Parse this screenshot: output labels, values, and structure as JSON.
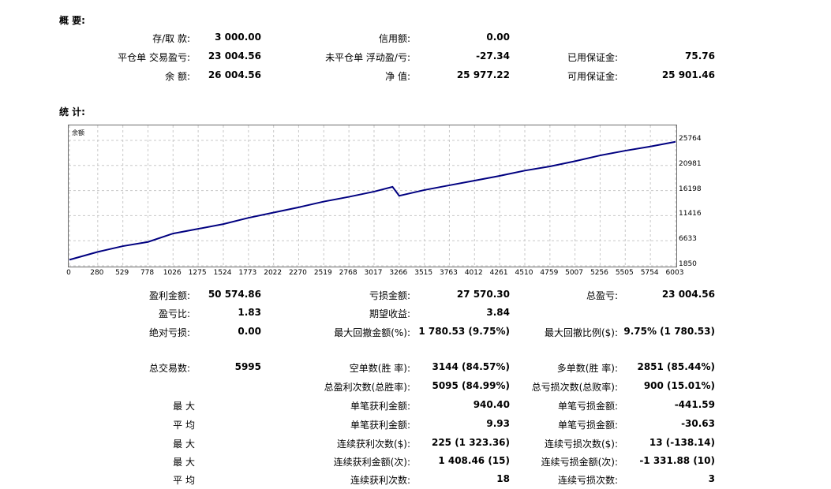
{
  "sections": {
    "summary": "概 要:",
    "stats": "统 计:"
  },
  "summary": {
    "deposit_label": "存/取 款:",
    "deposit_value": "3 000.00",
    "credit_label": "信用额:",
    "credit_value": "0.00",
    "closed_pl_label": "平仓单 交易盈亏:",
    "closed_pl_value": "23 004.56",
    "floating_pl_label": "未平仓单 浮动盈/亏:",
    "floating_pl_value": "-27.34",
    "margin_label": "已用保证金:",
    "margin_value": "75.76",
    "balance_label": "余 额:",
    "balance_value": "26 004.56",
    "equity_label": "净 值:",
    "equity_value": "25 977.22",
    "free_margin_label": "可用保证金:",
    "free_margin_value": "25 901.46"
  },
  "chart_data": {
    "type": "line",
    "series_label": "余额",
    "color": "#000080",
    "grid": true,
    "y_ticks": [
      "25764",
      "20981",
      "16198",
      "11416",
      "6633",
      "1850"
    ],
    "x_ticks": [
      "0",
      "280",
      "529",
      "778",
      "1026",
      "1275",
      "1524",
      "1773",
      "2022",
      "2270",
      "2519",
      "2768",
      "3017",
      "3266",
      "3515",
      "3763",
      "4012",
      "4261",
      "4510",
      "4759",
      "5007",
      "5256",
      "5505",
      "5754",
      "6003"
    ],
    "ylim": [
      1850,
      25764
    ],
    "xlim": [
      0,
      6003
    ],
    "series": [
      {
        "x": [
          0,
          280,
          529,
          778,
          1026,
          1275,
          1524,
          1773,
          2022,
          2270,
          2519,
          2768,
          3017,
          3200,
          3266,
          3515,
          3763,
          4012,
          4261,
          4510,
          4759,
          5007,
          5256,
          5505,
          5754,
          6003
        ],
        "values": [
          3000,
          4500,
          5600,
          6400,
          8000,
          8900,
          9800,
          11000,
          12000,
          13000,
          14100,
          15000,
          16000,
          16900,
          15200,
          16300,
          17200,
          18100,
          19000,
          20000,
          20800,
          21800,
          22900,
          23800,
          24600,
          25500
        ]
      }
    ]
  },
  "stats": {
    "gross_profit_label": "盈利金额:",
    "gross_profit_value": "50 574.86",
    "gross_loss_label": "亏损金额:",
    "gross_loss_value": "27 570.30",
    "net_profit_label": "总盈亏:",
    "net_profit_value": "23 004.56",
    "profit_factor_label": "盈亏比:",
    "profit_factor_value": "1.83",
    "expected_payoff_label": "期望收益:",
    "expected_payoff_value": "3.84",
    "abs_drawdown_label": "绝对亏损:",
    "abs_drawdown_value": "0.00",
    "max_dd_amount_label": "最大回撤金额(%):",
    "max_dd_amount_value": "1 780.53 (9.75%)",
    "max_dd_ratio_label": "最大回撤比例($):",
    "max_dd_ratio_value": "9.75% (1 780.53)",
    "total_trades_label": "总交易数:",
    "total_trades_value": "5995",
    "short_label": "空单数(胜 率):",
    "short_value": "3144 (84.57%)",
    "long_label": "多单数(胜 率):",
    "long_value": "2851 (85.44%)",
    "win_trades_label": "总盈利次数(总胜率):",
    "win_trades_value": "5095 (84.99%)",
    "loss_trades_label": "总亏损次数(总败率):",
    "loss_trades_value": "900 (15.01%)",
    "row_max1": "最 大",
    "largest_win_label": "单笔获利金额:",
    "largest_win_value": "940.40",
    "largest_loss_label": "单笔亏损金额:",
    "largest_loss_value": "-441.59",
    "row_avg1": "平 均",
    "avg_win_label": "单笔获利金额:",
    "avg_win_value": "9.93",
    "avg_loss_label": "单笔亏损金额:",
    "avg_loss_value": "-30.63",
    "row_max2": "最 大",
    "max_consec_wins_label": "连续获利次数($):",
    "max_consec_wins_value": "225 (1 323.36)",
    "max_consec_losses_label": "连续亏损次数($):",
    "max_consec_losses_value": "13 (-138.14)",
    "row_max3": "最 大",
    "max_consec_profit_label": "连续获利金额(次):",
    "max_consec_profit_value": "1 408.46 (15)",
    "max_consec_loss_label": "连续亏损金额(次):",
    "max_consec_loss_value": "-1 331.88 (10)",
    "row_avg2": "平 均",
    "avg_consec_wins_label": "连续获利次数:",
    "avg_consec_wins_value": "18",
    "avg_consec_losses_label": "连续亏损次数:",
    "avg_consec_losses_value": "3"
  }
}
